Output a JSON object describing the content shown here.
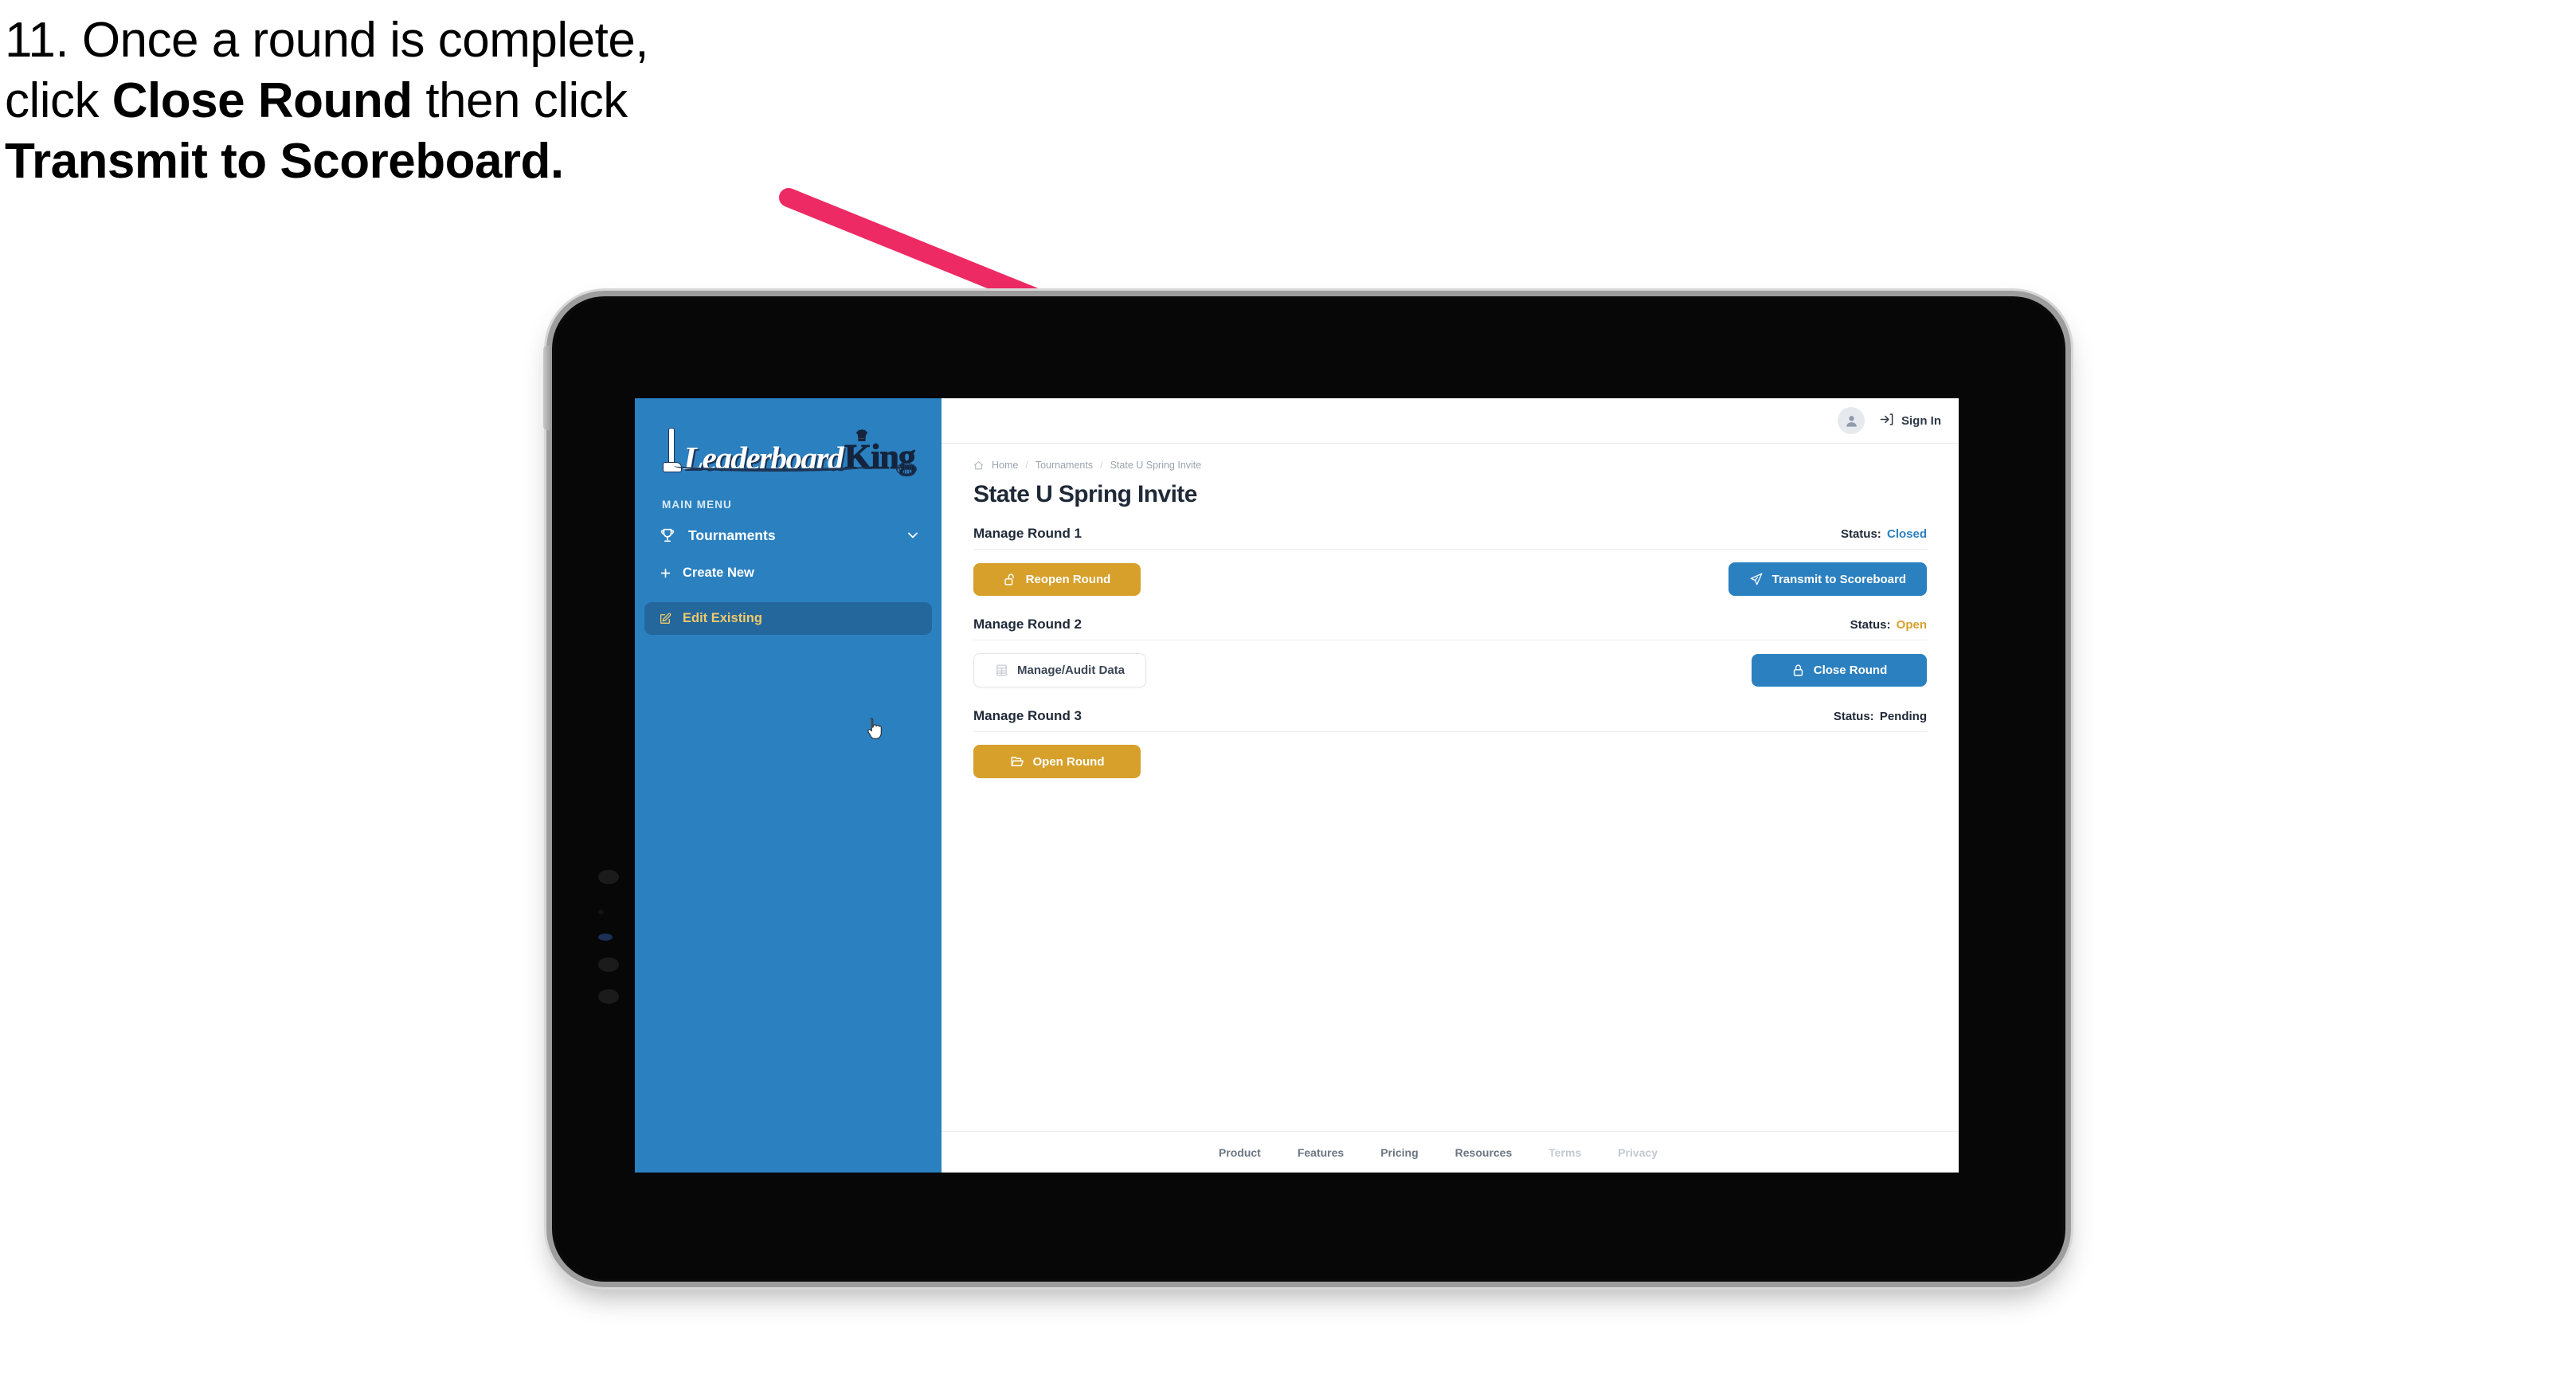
{
  "caption": {
    "line1": "11. Once a round is complete,",
    "line2_a": "click ",
    "line2_b": "Close Round",
    "line2_c": " then click",
    "line3": "Transmit to Scoreboard."
  },
  "colors": {
    "arrow": "#ED2A63",
    "sidebar_blue": "#2B80C0",
    "sidebar_active": "#23679C",
    "sidebar_active_text": "#F0C96A",
    "amber": "#D6A02B",
    "blue_button": "#2B80C0",
    "status_closed": "#2B80C0",
    "status_open": "#D6A02B",
    "status_pending": "#1F2937",
    "text_dark": "#1F2937",
    "muted": "#9AA3AE"
  },
  "app": {
    "logo": {
      "word_script": "Leaderboard",
      "word_king": "King",
      "crown_icon": "crown-icon",
      "club_icon": "golf-club-icon",
      "ball_icon": "golf-ball-icon"
    },
    "sidebar": {
      "section_label": "MAIN MENU",
      "group": {
        "label": "Tournaments",
        "icon": "trophy-icon",
        "chevron": "chevron-down-icon"
      },
      "items": [
        {
          "label": "Create New",
          "icon": "plus-icon",
          "active": false
        },
        {
          "label": "Edit Existing",
          "icon": "pencil-square-icon",
          "active": true
        }
      ],
      "cursor": "pointer-hand-cursor"
    },
    "topbar": {
      "avatar_icon": "user-avatar-icon",
      "signin_icon": "sign-in-icon",
      "signin_label": "Sign In"
    },
    "breadcrumb": {
      "home_icon": "home-icon",
      "items": [
        "Home",
        "Tournaments",
        "State U Spring Invite"
      ],
      "separator": "/"
    },
    "page_title": "State U Spring Invite",
    "status_prefix": "Status:",
    "rounds": [
      {
        "title": "Manage Round 1",
        "status": "Closed",
        "status_class": "closed",
        "left_button": {
          "label": "Reopen Round",
          "icon": "unlock-icon",
          "style": "amber"
        },
        "right_button": {
          "label": "Transmit to Scoreboard",
          "icon": "paper-plane-icon",
          "style": "blue"
        }
      },
      {
        "title": "Manage Round 2",
        "status": "Open",
        "status_class": "open",
        "left_button": {
          "label": "Manage/Audit Data",
          "icon": "table-grid-icon",
          "style": "ghost"
        },
        "right_button": {
          "label": "Close Round",
          "icon": "lock-icon",
          "style": "blue"
        }
      },
      {
        "title": "Manage Round 3",
        "status": "Pending",
        "status_class": "pending",
        "left_button": {
          "label": "Open Round",
          "icon": "open-folder-icon",
          "style": "amber"
        },
        "right_button": null
      }
    ],
    "footer": {
      "links": [
        {
          "label": "Product",
          "muted": false
        },
        {
          "label": "Features",
          "muted": false
        },
        {
          "label": "Pricing",
          "muted": false
        },
        {
          "label": "Resources",
          "muted": false
        },
        {
          "label": "Terms",
          "muted": true
        },
        {
          "label": "Privacy",
          "muted": true
        }
      ]
    }
  }
}
